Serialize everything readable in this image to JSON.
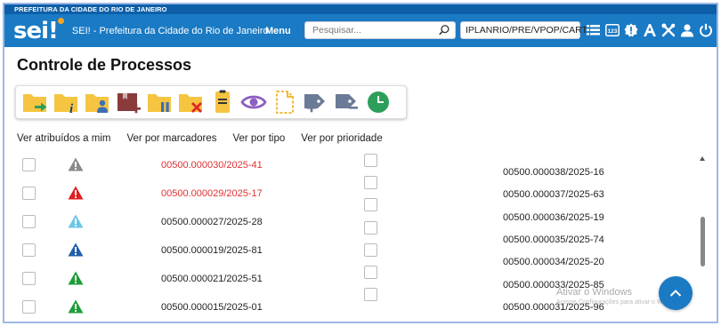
{
  "header": {
    "gov_strip": "PREFEITURA DA CIDADE DO RIO DE JANEIRO",
    "logo_text": "sei",
    "logo_bang": "!",
    "app_title": "SEI! - Prefeitura da Cidade do Rio de Janeiro",
    "menu_label": "Menu",
    "search_placeholder": "Pesquisar...",
    "unit_label": "IPLANRIO/PRE/VPOP/CART",
    "icons": [
      "list-icon",
      "calendar-123-icon",
      "alert-gear-icon",
      "font-icon",
      "tools-icon",
      "user-icon",
      "power-icon"
    ]
  },
  "page": {
    "title": "Controle de Processos"
  },
  "toolbar": {
    "buttons": [
      "new-process-icon",
      "process-info-icon",
      "assign-user-icon",
      "add-marker-icon",
      "pause-process-icon",
      "close-process-icon",
      "note-icon",
      "view-icon",
      "new-document-icon",
      "add-tag-icon",
      "tag-icon",
      "clock-icon"
    ]
  },
  "views": {
    "assigned": "Ver atribuídos a mim",
    "markers": "Ver por marcadores",
    "type": "Ver por tipo",
    "priority": "Ver por prioridade"
  },
  "received": [
    {
      "number": "00500.000030/2025-41",
      "color": "#e03030",
      "warn_color": "#8a8a8a"
    },
    {
      "number": "00500.000029/2025-17",
      "color": "#e03030",
      "warn_color": "#e02020"
    },
    {
      "number": "00500.000027/2025-28",
      "color": "#222222",
      "warn_color": "#6ec6e6"
    },
    {
      "number": "00500.000019/2025-81",
      "color": "#222222",
      "warn_color": "#1f5fa8"
    },
    {
      "number": "00500.000021/2025-51",
      "color": "#222222",
      "warn_color": "#1e9e3a"
    },
    {
      "number": "00500.000015/2025-01",
      "color": "#222222",
      "warn_color": "#1e9e3a"
    }
  ],
  "generated": [
    {
      "number": "00500.000038/2025-16"
    },
    {
      "number": "00500.000037/2025-63"
    },
    {
      "number": "00500.000036/2025-19"
    },
    {
      "number": "00500.000035/2025-74"
    },
    {
      "number": "00500.000034/2025-20"
    },
    {
      "number": "00500.000033/2025-85"
    },
    {
      "number": "00500.000031/2025-96"
    }
  ],
  "watermark": {
    "line1": "Ativar o Windows",
    "line2": "Acesse Configurações para ativar o Windows."
  },
  "colors": {
    "topbar": "#1a7ac4",
    "gov_strip": "#0d5fa8",
    "folder": "#f5c542",
    "accent_green": "#2e9e5b"
  }
}
